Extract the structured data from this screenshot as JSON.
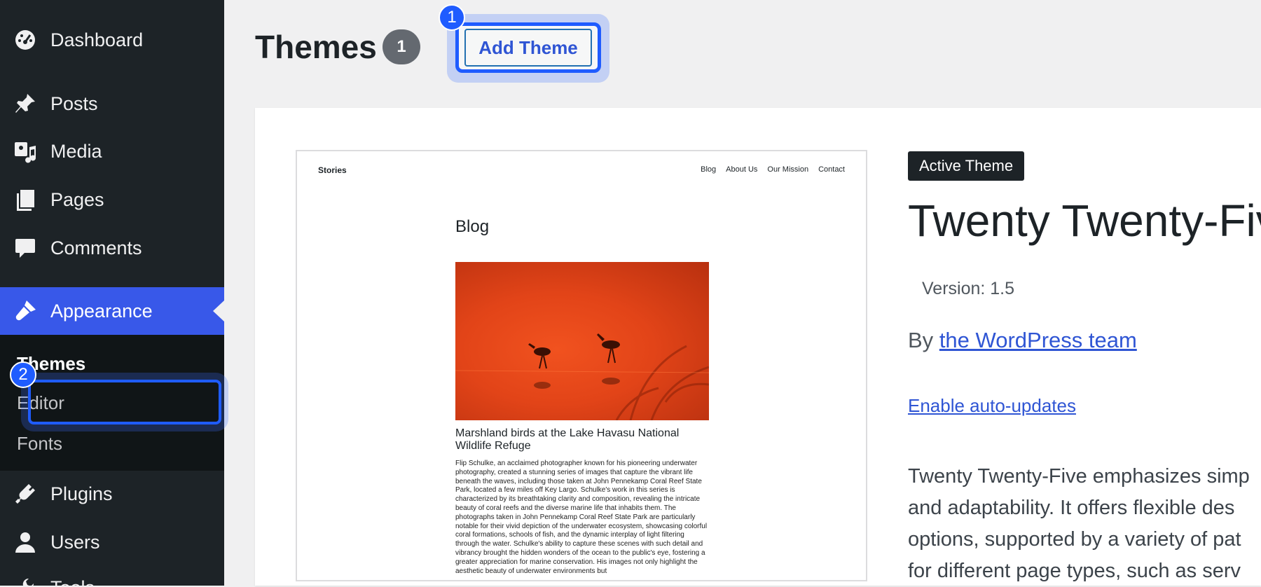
{
  "sidebar": {
    "items": [
      {
        "label": "Dashboard",
        "icon": "dashboard-icon"
      },
      {
        "label": "Posts",
        "icon": "pin-icon"
      },
      {
        "label": "Media",
        "icon": "media-icon"
      },
      {
        "label": "Pages",
        "icon": "pages-icon"
      },
      {
        "label": "Comments",
        "icon": "comment-icon"
      },
      {
        "label": "Appearance",
        "icon": "brush-icon",
        "active": true
      },
      {
        "label": "Plugins",
        "icon": "plugin-icon"
      },
      {
        "label": "Users",
        "icon": "user-icon"
      },
      {
        "label": "Tools",
        "icon": "wrench-icon"
      }
    ],
    "submenu": [
      {
        "label": "Themes",
        "current": true
      },
      {
        "label": "Editor"
      },
      {
        "label": "Fonts"
      }
    ]
  },
  "header": {
    "title": "Themes",
    "count": "1",
    "add_theme_label": "Add Theme"
  },
  "steps": {
    "one": "1",
    "two": "2"
  },
  "theme": {
    "active_label": "Active Theme",
    "name": "Twenty Twenty-Five",
    "version": "Version: 1.5",
    "by": "By",
    "author": "the WordPress team",
    "auto_updates": "Enable auto-updates",
    "description_lines": [
      "Twenty Twenty-Five emphasizes simp",
      "and adaptability. It offers flexible des",
      "options, supported by a variety of pat",
      "for different page types, such as serv"
    ]
  },
  "preview": {
    "site_title": "Stories",
    "nav": [
      "Blog",
      "About Us",
      "Our Mission",
      "Contact"
    ],
    "heading": "Blog",
    "post_title": "Marshland birds at the Lake Havasu National Wildlife Refuge",
    "excerpt": "Flip Schulke, an acclaimed photographer known for his pioneering underwater photography, created a stunning series of images that capture the vibrant life beneath the waves, including those taken at John Pennekamp Coral Reef State Park, located a few miles off Key Largo. Schulke's work in this series is characterized by its breathtaking clarity and composition, revealing the intricate beauty of coral reefs and the diverse marine life that inhabits them. The photographs taken in John Pennekamp Coral Reef State Park are particularly notable for their vivid depiction of the underwater ecosystem, showcasing colorful coral formations, schools of fish, and the dynamic interplay of light filtering through the water. Schulke's ability to capture these scenes with such detail and vibrancy brought the hidden wonders of the ocean to the public's eye, fostering a greater appreciation for marine conservation. His images not only highlight the aesthetic beauty of underwater environments but"
  },
  "colors": {
    "sidebar_bg": "#1d2327",
    "accent": "#3858e9",
    "highlight": "#1f5cff",
    "link": "#2f55d4"
  }
}
